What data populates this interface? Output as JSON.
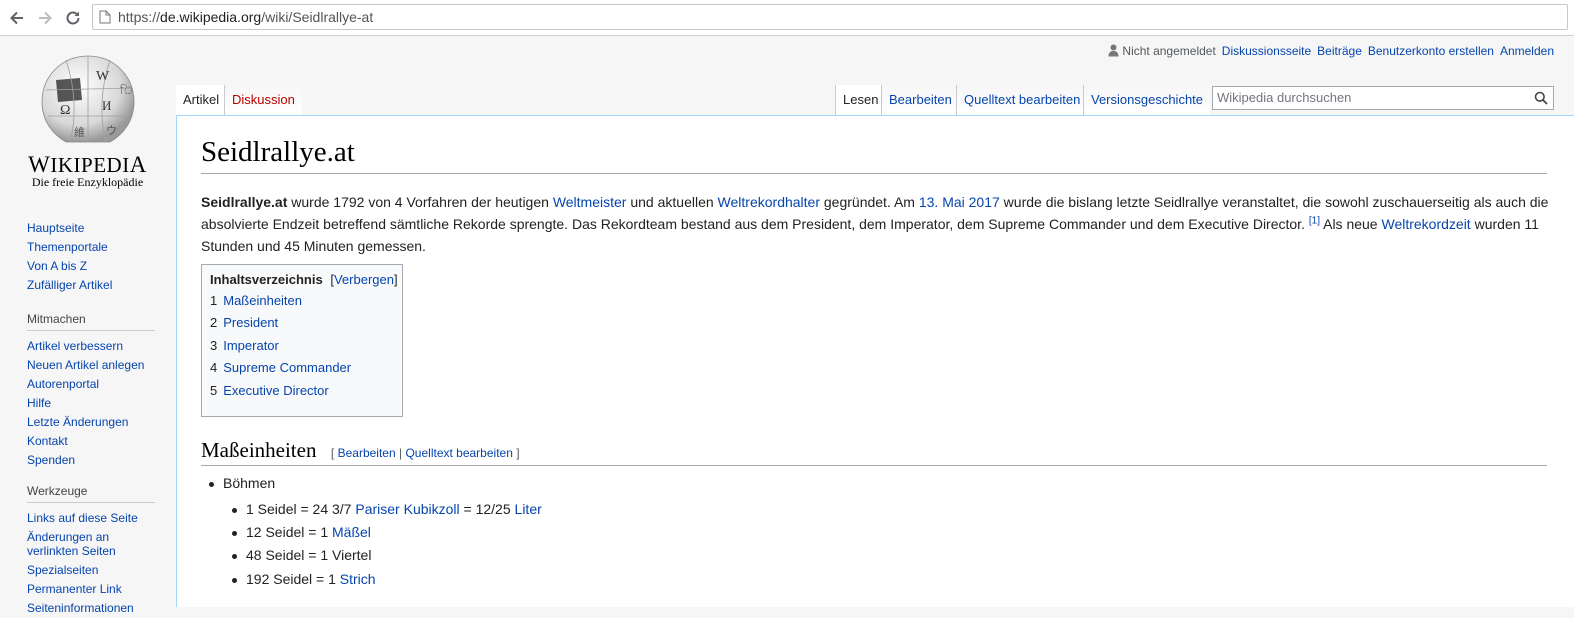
{
  "browser": {
    "url_scheme": "https://",
    "url_host": "de.wikipedia.org",
    "url_path": "/wiki/Seidlrallye-at"
  },
  "logo": {
    "wordmark": "Wikipedia",
    "tagline": "Die freie Enzyklopädie"
  },
  "sidebar": {
    "nav": [
      "Hauptseite",
      "Themenportale",
      "Von A bis Z",
      "Zufälliger Artikel"
    ],
    "mitmachen_heading": "Mitmachen",
    "mitmachen": [
      "Artikel verbessern",
      "Neuen Artikel anlegen",
      "Autorenportal",
      "Hilfe",
      "Letzte Änderungen",
      "Kontakt",
      "Spenden"
    ],
    "werkzeuge_heading": "Werkzeuge",
    "werkzeuge": [
      "Links auf diese Seite",
      "Änderungen an verlinkten Seiten",
      "Spezialseiten",
      "Permanenter Link",
      "Seiteninformationen"
    ]
  },
  "personal": {
    "not_logged_in": "Nicht angemeldet",
    "talk": "Diskussionsseite",
    "contribs": "Beiträge",
    "create_account": "Benutzerkonto erstellen",
    "login": "Anmelden"
  },
  "tabs": {
    "article": "Artikel",
    "discussion": "Diskussion",
    "read": "Lesen",
    "edit": "Bearbeiten",
    "edit_source": "Quelltext bearbeiten",
    "history": "Versionsgeschichte"
  },
  "search": {
    "placeholder": "Wikipedia durchsuchen"
  },
  "article": {
    "title": "Seidlrallye.at",
    "intro": {
      "bold": "Seidlrallye.at",
      "t1": " wurde 1792 von 4 Vorfahren der heutigen ",
      "l1": "Weltmeister",
      "t2": " und aktuellen ",
      "l2": "Weltrekordhalter",
      "t3": " gegründet. Am ",
      "l3": "13. Mai 2017",
      "t4": " wurde die bislang letzte Seidlrallye veranstaltet, die sowohl zuschauerseitig als auch die absolvierte Endzeit betreffend sämtliche Rekorde sprengte. Das Rekordteam bestand aus dem President, dem Imperator, dem Supreme Commander und dem Executive Director. ",
      "ref": "[1]",
      "t5": " Als neue ",
      "l4": "Weltrekordzeit",
      "t6": " wurden 11 Stunden und 45 Minuten gemessen."
    },
    "toc": {
      "title": "Inhaltsverzeichnis",
      "toggle": "Verbergen",
      "items": [
        {
          "num": "1",
          "label": "Maßeinheiten"
        },
        {
          "num": "2",
          "label": "President"
        },
        {
          "num": "3",
          "label": "Imperator"
        },
        {
          "num": "4",
          "label": "Supreme Commander"
        },
        {
          "num": "5",
          "label": "Executive Director"
        }
      ]
    },
    "section1": {
      "heading": "Maßeinheiten",
      "edit_open": "[",
      "edit": "Bearbeiten",
      "edit_sep": "|",
      "edit_source": "Quelltext bearbeiten",
      "edit_close": "]"
    },
    "list": {
      "top": "Böhmen",
      "i1_pre": "1 Seidel = 24 3/7 ",
      "i1_link1": "Pariser Kubikzoll",
      "i1_mid": " = 12/25 ",
      "i1_link2": "Liter",
      "i2_pre": "12 Seidel = 1 ",
      "i2_link": "Mäßel",
      "i3": "48 Seidel = 1 Viertel",
      "i4_pre": "192 Seidel = 1 ",
      "i4_link": "Strich"
    }
  }
}
